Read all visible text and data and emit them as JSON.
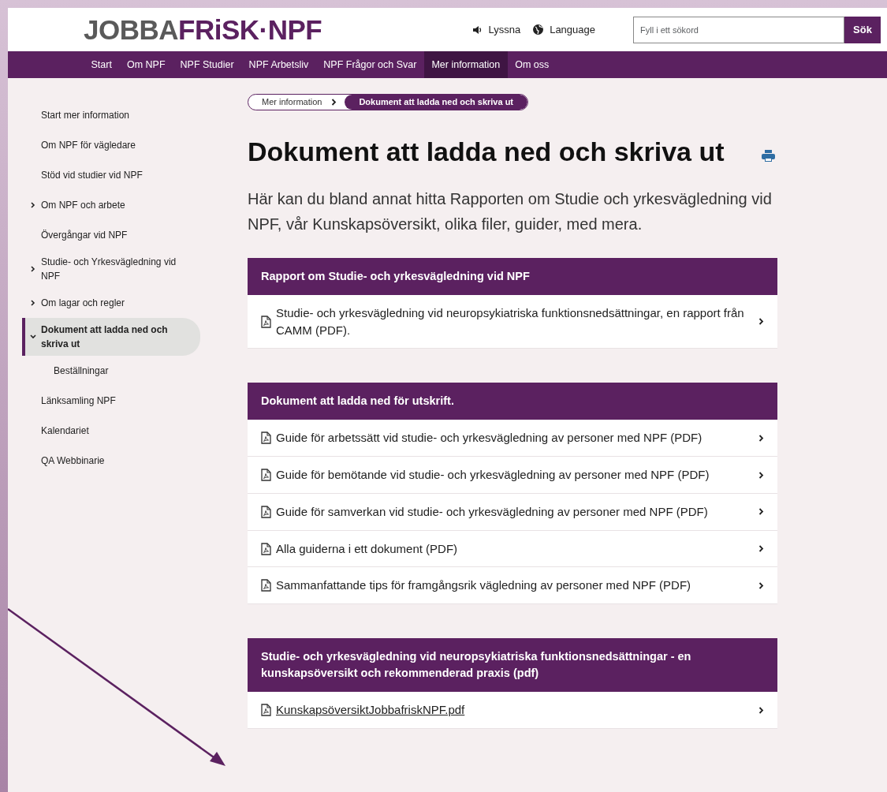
{
  "logo": {
    "first": "JOBBA",
    "second": "FRiSK·NPF"
  },
  "header_links": [
    {
      "label": "Lyssna",
      "kind": "listen"
    },
    {
      "label": "Language",
      "kind": "language"
    }
  ],
  "search": {
    "placeholder": "Fyll i ett sökord",
    "button": "Sök"
  },
  "nav": [
    {
      "label": "Start",
      "selected": false
    },
    {
      "label": "Om NPF",
      "selected": false
    },
    {
      "label": "NPF Studier",
      "selected": false
    },
    {
      "label": "NPF Arbetsliv",
      "selected": false
    },
    {
      "label": "NPF Frågor och Svar",
      "selected": false
    },
    {
      "label": "Mer information",
      "selected": true
    },
    {
      "label": "Om oss",
      "selected": false
    }
  ],
  "sidebar": {
    "items": [
      {
        "label": "Start mer information",
        "selected": false
      },
      {
        "label": "Om NPF för vägledare",
        "selected": false
      },
      {
        "label": "Stöd vid studier vid NPF",
        "selected": false
      },
      {
        "label": "Om NPF och arbete",
        "expanded": false,
        "selected": false
      },
      {
        "label": "Övergångar vid NPF",
        "selected": false
      },
      {
        "label": "Studie- och Yrkesvägledning vid NPF",
        "expanded": false,
        "selected": false
      },
      {
        "label": "Om lagar och regler",
        "expanded": false,
        "selected": false
      },
      {
        "label": "Dokument att ladda ned och skriva ut",
        "expanded": true,
        "selected": true,
        "children": [
          {
            "label": "Beställningar",
            "selected": false
          }
        ]
      },
      {
        "label": "Länksamling NPF",
        "selected": false
      },
      {
        "label": "Kalendariet",
        "selected": false
      },
      {
        "label": "QA Webbinarie",
        "selected": false
      }
    ]
  },
  "breadcrumb": [
    {
      "label": "Mer information",
      "selected": false
    },
    {
      "label": "Dokument att ladda ned och skriva ut",
      "selected": true
    }
  ],
  "title": "Dokument att ladda ned och skriva ut",
  "intro": "Här kan du bland annat hitta Rapporten om Studie och yrkesvägledning vid NPF, vår Kunskapsöversikt, olika filer, guider, med mera.",
  "sections": [
    {
      "heading": "Rapport om Studie- och yrkesvägledning vid NPF",
      "items": [
        {
          "label": "Studie- och yrkesvägledning vid neuropsykiatriska funktionsnedsättningar, en rapport från CAMM (PDF).",
          "underlined": false
        }
      ]
    },
    {
      "heading": "Dokument att ladda ned för utskrift.",
      "items": [
        {
          "label": "Guide för arbetssätt vid studie- och yrkesvägledning av personer med NPF (PDF)",
          "underlined": false
        },
        {
          "label": "Guide för bemötande vid studie- och yrkesvägledning av personer med NPF (PDF)",
          "underlined": false
        },
        {
          "label": "Guide för samverkan vid studie- och yrkesvägledning av personer med NPF (PDF)",
          "underlined": false
        },
        {
          "label": "Alla guiderna i ett dokument (PDF)",
          "underlined": false
        },
        {
          "label": "Sammanfattande tips för framgångsrik vägledning av personer med NPF (PDF)",
          "underlined": false
        }
      ]
    },
    {
      "heading": "Studie- och yrkesvägledning vid neuropsykiatriska funktionsnedsättningar - en kunskapsöversikt och rekommenderad praxis (pdf)",
      "items": [
        {
          "label": "KunskapsöversiktJobbafriskNPF.pdf",
          "underlined": true
        }
      ]
    }
  ]
}
